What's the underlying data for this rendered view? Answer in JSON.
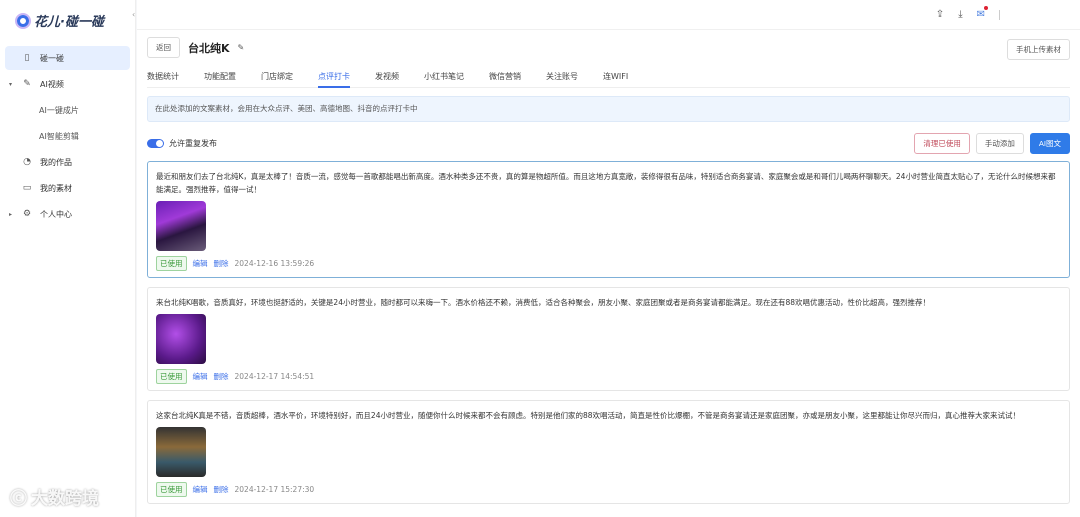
{
  "app": {
    "logo": "花儿·碰一碰"
  },
  "sidebar": {
    "items": [
      {
        "label": "碰一碰",
        "icon": "phone-icon"
      },
      {
        "label": "AI视频",
        "icon": "pen-icon"
      },
      {
        "label": "AI一键成片"
      },
      {
        "label": "AI智能剪辑"
      },
      {
        "label": "我的作品",
        "icon": "works-icon"
      },
      {
        "label": "我的素材",
        "icon": "folder-icon"
      },
      {
        "label": "个人中心",
        "icon": "gear-icon"
      }
    ]
  },
  "header": {
    "back": "返回",
    "title": "台北纯K",
    "upload": "手机上传素材"
  },
  "tabs": [
    "数据统计",
    "功能配置",
    "门店绑定",
    "点评打卡",
    "发视频",
    "小红书笔记",
    "微信营销",
    "关注账号",
    "连WIFI"
  ],
  "notice": "在此处添加的文案素材，会用在大众点评、美团、高德地图、抖音的点评打卡中",
  "toolbar": {
    "toggle_label": "允许重复发布",
    "toggle_on": true,
    "clear": "清理已使用",
    "manual": "手动添加",
    "ai": "AI图文"
  },
  "items": [
    {
      "text": "最近和朋友们去了台北纯K，真是太棒了！音质一流，感觉每一首歌都能唱出新高度。酒水种类多还不贵，真的算是物超所值。而且这地方真宽敞，装修得很有品味，特别适合商务宴请、家庭聚会或是和哥们儿喝两杯聊聊天。24小时营业简直太贴心了，无论什么时候想来都能满足。强烈推荐，值得一试！",
      "status": "已使用",
      "edit": "编辑",
      "delete": "删除",
      "time": "2024-12-16 13:59:26"
    },
    {
      "text": "来台北纯K唱歌，音质真好，环境也挺舒适的，关键是24小时营业，随时都可以来嗨一下。酒水价格还不赖，消费低，适合各种聚会，朋友小聚、家庭团聚或者是商务宴请都能满足。现在还有88欢唱优惠活动，性价比超高，强烈推荐！",
      "status": "已使用",
      "edit": "编辑",
      "delete": "删除",
      "time": "2024-12-17 14:54:51"
    },
    {
      "text": "这家台北纯K真是不错，音质超棒，酒水平价，环境特别好，而且24小时营业，随便你什么时候来都不会有顾虑。特别是他们家的88欢唱活动，简直是性价比爆棚，不管是商务宴请还是家庭团聚，亦或是朋友小聚，这里都能让你尽兴而归，真心推荐大家来试试！",
      "status": "已使用",
      "edit": "编辑",
      "delete": "删除",
      "time": "2024-12-17 15:27:30"
    }
  ],
  "watermark": "大数跨境"
}
